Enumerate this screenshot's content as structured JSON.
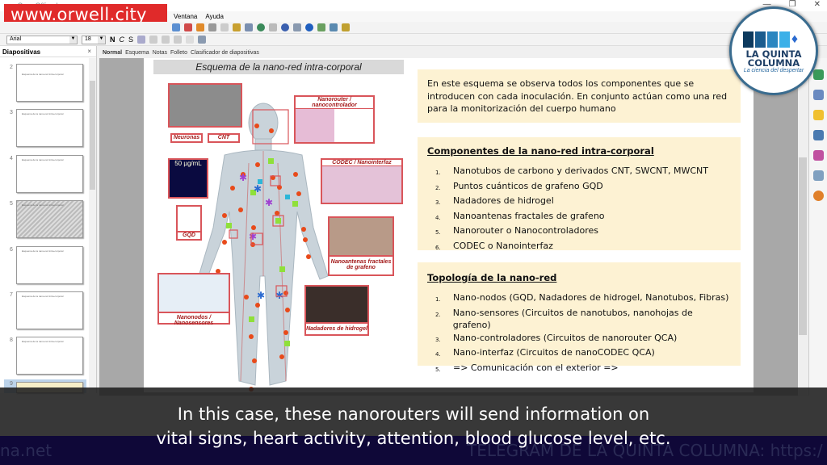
{
  "window": {
    "title": "...OpenOffice Impress",
    "controls": [
      "—",
      "❐",
      "✕"
    ]
  },
  "watermark": "www.orwell.city",
  "menu": [
    "Ventana",
    "Ayuda"
  ],
  "format_toolbar": {
    "font": "Arial",
    "size": "18",
    "bold": "N",
    "italic": "C",
    "shadow": "S"
  },
  "sidebar": {
    "title": "Diapositivas",
    "close": "×",
    "slides": [
      {
        "num": "2",
        "title": "Esquema de la nano-red intra-corporal"
      },
      {
        "num": "3",
        "title": "Esquema de la nano-red intra-corporal"
      },
      {
        "num": "4",
        "title": "Esquema de la nano-red intra-corporal"
      },
      {
        "num": "5",
        "title": "Esquema de la nano-red intra-corporal"
      },
      {
        "num": "6",
        "title": "Esquema de la nano-red intra-corporal"
      },
      {
        "num": "7",
        "title": "Esquema de la nano-red intra-corporal"
      },
      {
        "num": "8",
        "title": "Esquema de la nano-red intra-corporal"
      },
      {
        "num": "9",
        "title": ""
      }
    ]
  },
  "view_tabs": [
    "Normal",
    "Esquema",
    "Notas",
    "Folleto",
    "Clasificador de diapositivas"
  ],
  "slide": {
    "title": "Esquema de la nano-red intra-corporal",
    "figure_labels": {
      "neuronas": "Neuronas",
      "cnt": "CNT",
      "nanorouter": "Nanorouter / nanocontrolador",
      "codec": "CODEC / Nanointerfaz",
      "concentration": "50 µg/mL",
      "gqd": "GQD",
      "antenas": "Nanoantenas fractales de grafeno",
      "nanonodos": "Nanonodos / Nanosensores",
      "hidrogel": "Nadadores de hidrogel"
    },
    "intro": "En este esquema se observa todos los componentes que se introducen con cada inoculación. En conjunto actúan como una red para la monitorización del cuerpo humano",
    "components": {
      "heading": "Componentes de la nano-red intra-corporal",
      "items": [
        "Nanotubos de carbono y derivados CNT, SWCNT, MWCNT",
        "Puntos cuánticos de grafeno GQD",
        "Nadadores de hidrogel",
        "Nanoantenas fractales de grafeno",
        "Nanorouter o Nanocontroladores",
        "CODEC o Nanointerfaz"
      ]
    },
    "topology": {
      "heading": "Topología de la nano-red",
      "items": [
        "Nano-nodos (GQD, Nadadores de hidrogel, Nanotubos, Fibras)",
        "Nano-sensores (Circuitos de nanotubos, nanohojas de grafeno)",
        "Nano-controladores (Circuitos de nanorouter QCA)",
        "Nano-interfaz (Circuitos de nanoCODEC QCA)",
        "=> Comunicación con el exterior =>"
      ]
    }
  },
  "logo": {
    "line1": "LA QUINTA",
    "line2": "COLUMNA",
    "tagline": "La ciencia del despertar"
  },
  "subtitle": {
    "line1": "In this case, these nanorouters will send information on",
    "line2": "vital signs, heart activity, attention, blood glucose level, etc."
  },
  "banner": {
    "left": "na.net",
    "right": "TELEGRAM DE LA QUINTA COLUMNA: https:/"
  }
}
